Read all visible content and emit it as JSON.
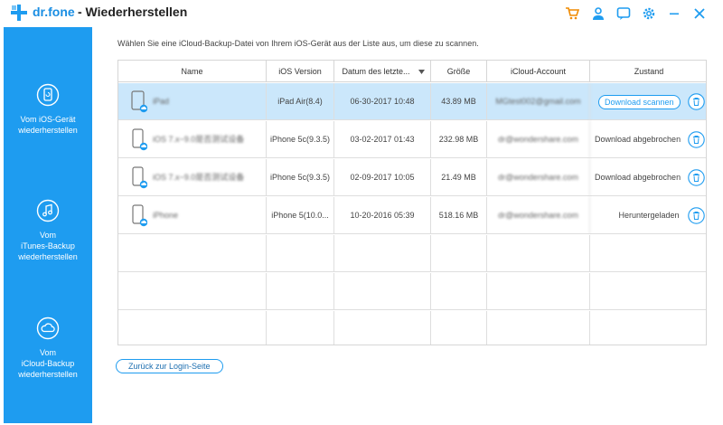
{
  "window": {
    "brand": "dr.fone",
    "title": "- Wiederherstellen",
    "accent": "#1e9cf0",
    "icons": [
      "cart-icon",
      "user-icon",
      "feedback-icon",
      "settings-icon",
      "minimize-icon",
      "close-icon"
    ]
  },
  "sidebar": {
    "items": [
      {
        "label_lines": [
          "Vom iOS-Gerät",
          "wiederherstellen"
        ],
        "icon": "phone-restore-icon",
        "active": false
      },
      {
        "label_lines": [
          "Vom",
          "iTunes-Backup",
          "wiederherstellen"
        ],
        "icon": "music-note-icon",
        "active": false
      },
      {
        "label_lines": [
          "Vom",
          "iCloud-Backup",
          "wiederherstellen"
        ],
        "icon": "cloud-icon",
        "active": true
      }
    ]
  },
  "main": {
    "instruction": "Wählen Sie eine iCloud-Backup-Datei von Ihrem iOS-Gerät aus der Liste aus, um diese zu scannen.",
    "table": {
      "headers": [
        "Name",
        "iOS Version",
        "Datum des letzte...",
        "Größe",
        "iCloud-Account",
        "Zustand"
      ],
      "sorted_column": "Datum des letzte...",
      "rows": [
        {
          "name": "iPad",
          "ios": "iPad Air(8.4)",
          "date": "06-30-2017 10:48",
          "size": "43.89 MB",
          "account": "MGtest002@gmail.com",
          "status": "Download scannen",
          "status_is_button": true,
          "selected": true
        },
        {
          "name": "iOS 7.x~9.0是否测试设备",
          "ios": "iPhone 5c(9.3.5)",
          "date": "03-02-2017 01:43",
          "size": "232.98 MB",
          "account": "dr@wondershare.com",
          "status": "Download abgebrochen",
          "status_is_button": false,
          "selected": false
        },
        {
          "name": "iOS 7.x~9.0是否测试设备",
          "ios": "iPhone 5c(9.3.5)",
          "date": "02-09-2017 10:05",
          "size": "21.49 MB",
          "account": "dr@wondershare.com",
          "status": "Download abgebrochen",
          "status_is_button": false,
          "selected": false
        },
        {
          "name": "iPhone",
          "ios": "iPhone 5(10.0...",
          "date": "10-20-2016 05:39",
          "size": "518.16 MB",
          "account": "dr@wondershare.com",
          "status": "Heruntergeladen",
          "status_is_button": false,
          "selected": false
        }
      ],
      "empty_rows": 3
    },
    "back_button": "Zurück zur Login-Seite"
  }
}
